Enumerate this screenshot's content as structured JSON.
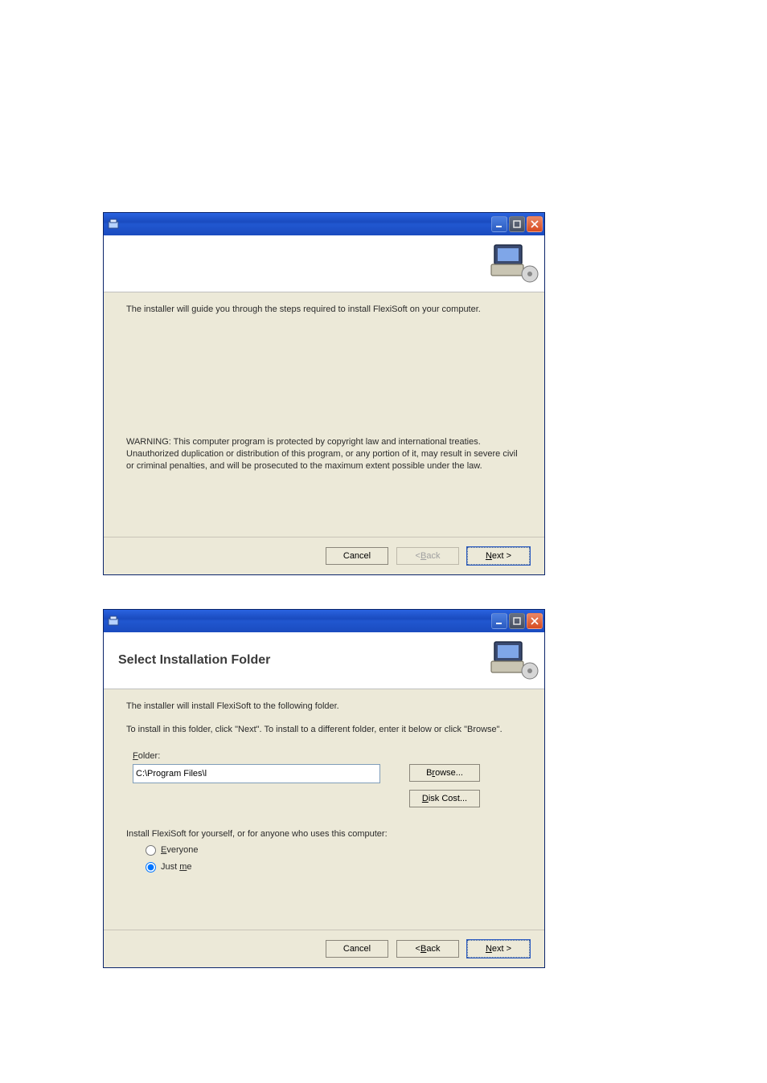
{
  "colors": {
    "titlebar_start": "#2a63e0",
    "titlebar_end": "#1a4bbf",
    "panel_bg": "#ece9d8",
    "close_start": "#e98765",
    "close_end": "#d84b20",
    "input_border": "#7f9db9"
  },
  "win1": {
    "body_text": "The installer will guide you through the steps required to install FlexiSoft on your computer.",
    "warning_text": "WARNING: This computer program is protected by copyright law and international treaties. Unauthorized duplication or distribution of this program, or any portion of it, may result in severe civil or criminal penalties, and will be prosecuted to the maximum extent possible under the law.",
    "buttons": {
      "cancel": "Cancel",
      "back": "< Back",
      "next": "Next >"
    }
  },
  "win2": {
    "header_title": "Select Installation Folder",
    "body_text1": "The installer will install FlexiSoft to the following folder.",
    "body_text2": "To install in this folder, click \"Next\". To install to a different folder, enter it below or click \"Browse\".",
    "folder_label": "Folder:",
    "folder_value": "C:\\Program Files\\l",
    "browse": "Browse...",
    "disk_cost": "Disk Cost...",
    "install_for_label": "Install FlexiSoft for yourself, or for anyone who uses this computer:",
    "radio_everyone": "Everyone",
    "radio_just_me": "Just me",
    "radio_selected": "just_me",
    "buttons": {
      "cancel": "Cancel",
      "back": "< Back",
      "next": "Next >"
    }
  }
}
